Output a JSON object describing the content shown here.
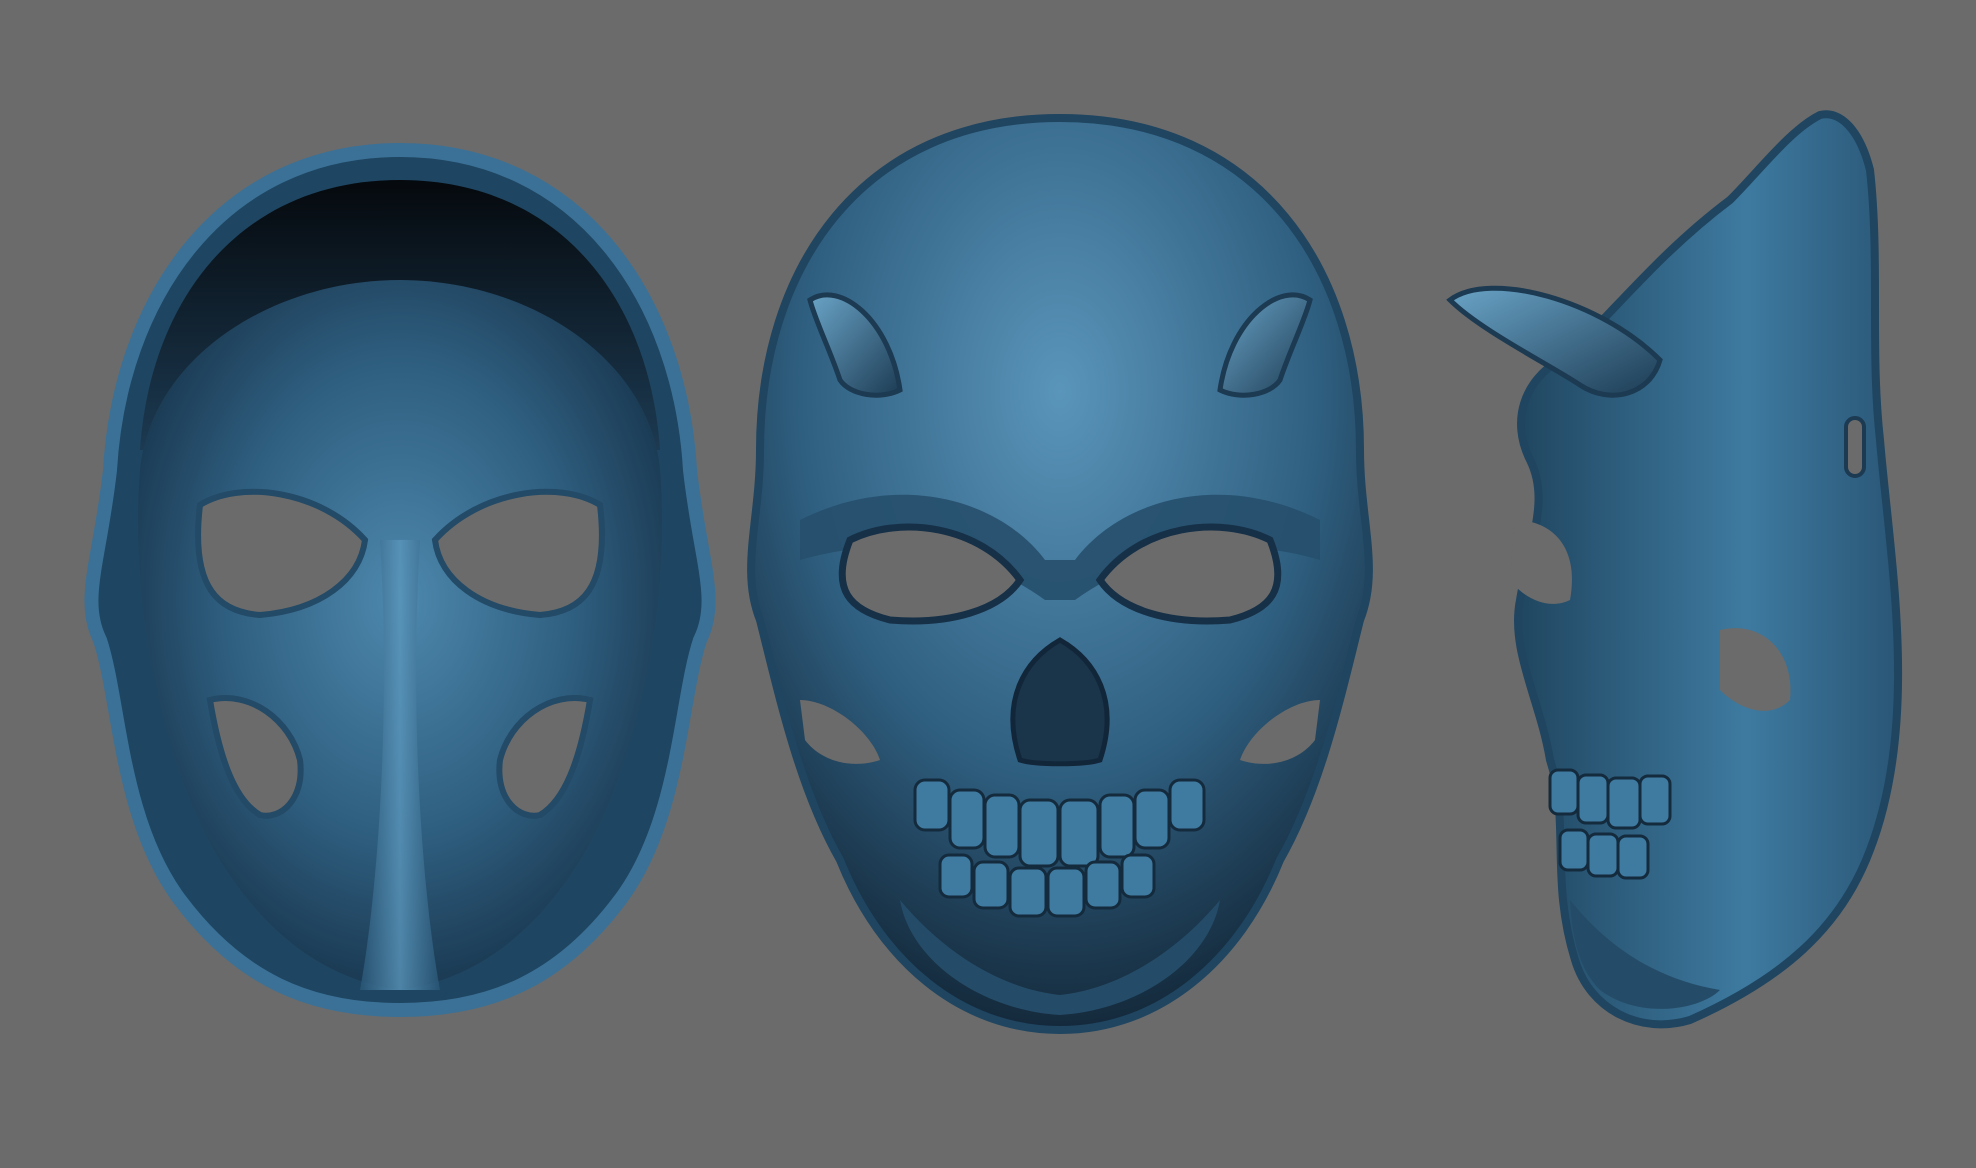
{
  "scene": {
    "background_color": "#6b6b6b",
    "material_color": "#2f5f80",
    "material_highlight": "#4d88ad",
    "material_shadow": "#13283a"
  },
  "views": [
    {
      "id": "back",
      "description_icon": "mask-interior-back-view"
    },
    {
      "id": "front",
      "description_icon": "demon-skull-front-view"
    },
    {
      "id": "side",
      "description_icon": "demon-skull-side-view"
    }
  ]
}
